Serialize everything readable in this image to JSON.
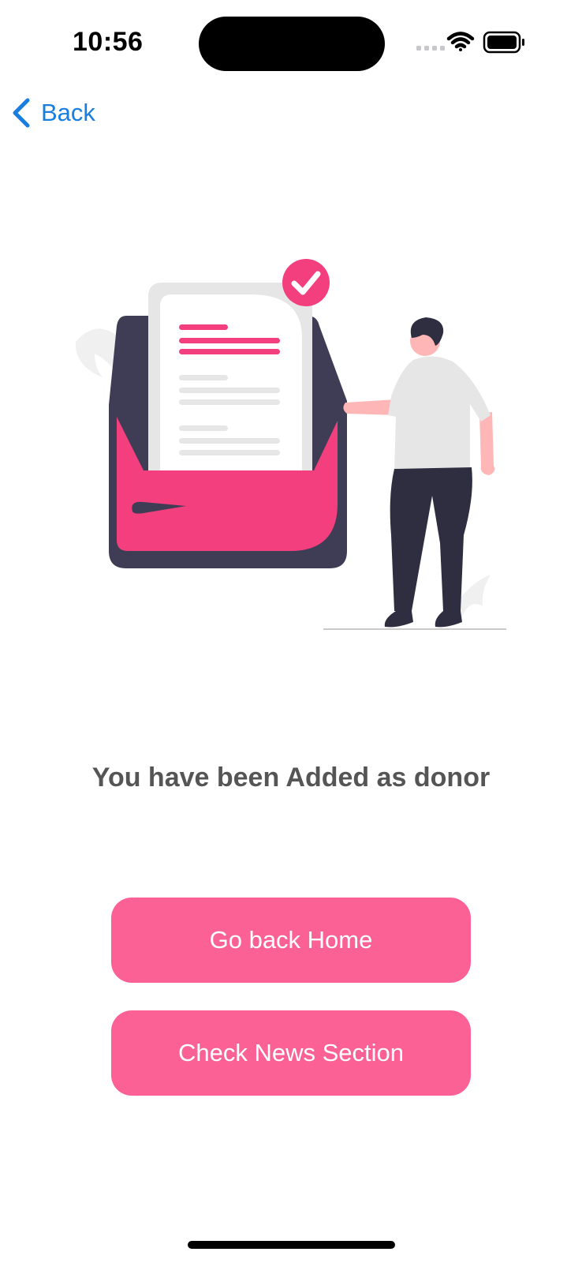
{
  "status_bar": {
    "time": "10:56",
    "icons": [
      "cellular-icon",
      "wifi-icon",
      "battery-icon"
    ]
  },
  "nav": {
    "back_label": "Back",
    "back_icon": "chevron-left-icon"
  },
  "illustration": {
    "name": "donor-confirmation-illustration",
    "icons": [
      "check-badge-icon",
      "document-icon",
      "folder-icon",
      "person-icon"
    ]
  },
  "message": "You have been Added as donor",
  "buttons": {
    "home_label": "Go back Home",
    "news_label": "Check News Section"
  },
  "colors": {
    "accent": "#fc6196",
    "illustration_pink": "#f43f7e",
    "link": "#1a7de0",
    "text_gray": "#555555",
    "folder_dark": "#3f3d56"
  }
}
